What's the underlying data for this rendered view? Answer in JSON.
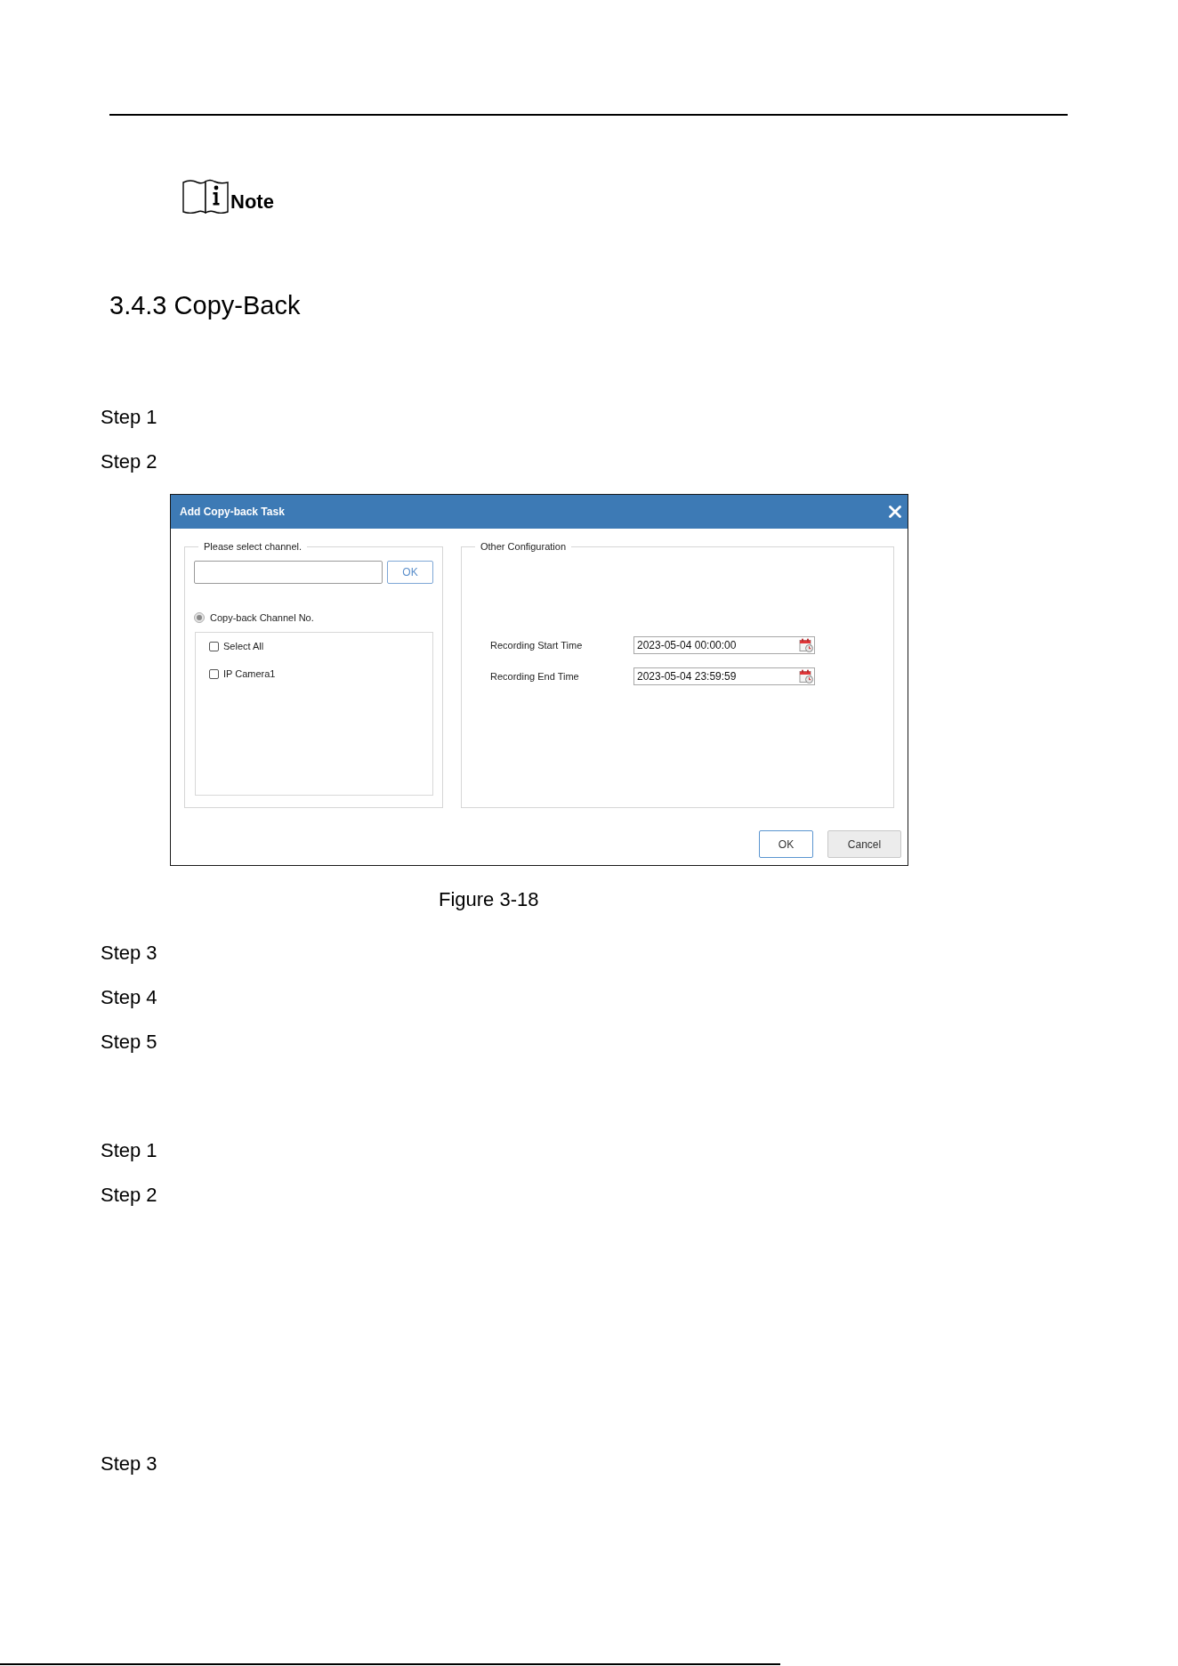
{
  "note": {
    "label": "Note"
  },
  "heading": "3.4.3 Copy-Back",
  "procedure_1": {
    "steps": [
      "Step 1",
      "Step 2"
    ],
    "figure": {
      "dialog": {
        "title": "Add Copy-back Task",
        "channel_panel": {
          "legend": "Please select channel.",
          "search_button": "OK",
          "mode": {
            "label": "Copy-back Channel No.",
            "checked": true,
            "disabled": true
          },
          "channels": [
            {
              "label": "Select All",
              "checked": false
            },
            {
              "label": "IP Camera1",
              "checked": false
            }
          ]
        },
        "config_panel": {
          "legend": "Other Configuration",
          "fields": [
            {
              "label": "Recording Start Time",
              "value": "2023-05-04 00:00:00"
            },
            {
              "label": "Recording End Time",
              "value": "2023-05-04 23:59:59"
            }
          ]
        },
        "buttons": [
          {
            "label": "OK",
            "kind": "primary"
          },
          {
            "label": "Cancel",
            "kind": "secondary"
          }
        ]
      },
      "caption": "Figure 3-18"
    },
    "more_steps": [
      "Step 3",
      "Step 4",
      "Step 5"
    ]
  },
  "procedure_2": {
    "steps": [
      "Step 1",
      "Step 2"
    ],
    "more_steps": [
      "Step 3"
    ]
  }
}
